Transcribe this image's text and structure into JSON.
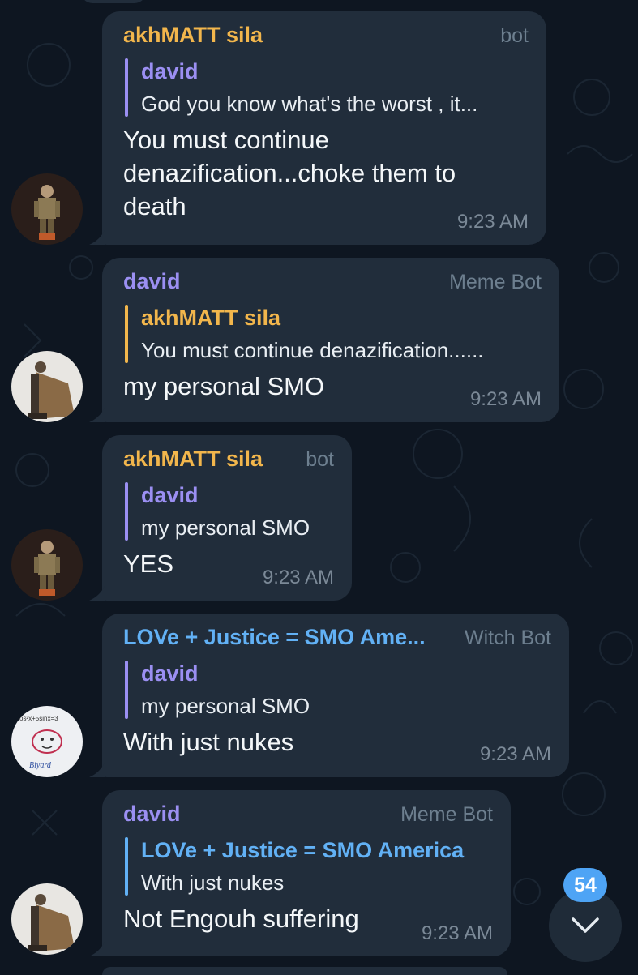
{
  "colors": {
    "background": "#0e1621",
    "bubble": "#212d3b",
    "sender_orange": "#f2b64c",
    "sender_purple": "#9b8ff2",
    "sender_blue": "#62b1f5",
    "badge": "#4ea4f5"
  },
  "messages": [
    {
      "sender": "akhMATT sila",
      "role": "bot",
      "reply_to": {
        "name": "david",
        "text": "God you know what's the worst , it..."
      },
      "text_lines": [
        "You must continue",
        "denazification...choke them to",
        "death"
      ],
      "time": "9:23 AM",
      "avatar": "soldier-avatar"
    },
    {
      "sender": "david",
      "role": "Meme Bot",
      "reply_to": {
        "name": "akhMATT sila",
        "text": "You must continue denazification......"
      },
      "text_lines": [
        "my personal SMO"
      ],
      "time": "9:23 AM",
      "avatar": "statue-avatar"
    },
    {
      "sender": "akhMATT sila",
      "role": "bot",
      "reply_to": {
        "name": "david",
        "text": "my personal SMO"
      },
      "text_lines": [
        "YES"
      ],
      "time": "9:23 AM",
      "avatar": "soldier-avatar"
    },
    {
      "sender": "LOVe + Justice = SMO Ame...",
      "role": "Witch Bot",
      "reply_to": {
        "name": "david",
        "text": "my personal SMO"
      },
      "text_lines": [
        "With just nukes"
      ],
      "time": "9:23 AM",
      "avatar": "doodle-avatar"
    },
    {
      "sender": "david",
      "role": "Meme Bot",
      "reply_to": {
        "name": "LOVe + Justice = SMO America",
        "text": "With just nukes"
      },
      "text_lines": [
        "Not Engouh suffering"
      ],
      "time": "9:23 AM",
      "avatar": "statue-avatar"
    }
  ],
  "avatar_texts": {
    "doodle_top": "cos²x+5sinx=3",
    "doodle_sig": "Biyard"
  },
  "unread_badge": "54",
  "scroll_button_icon": "chevron-down-icon"
}
